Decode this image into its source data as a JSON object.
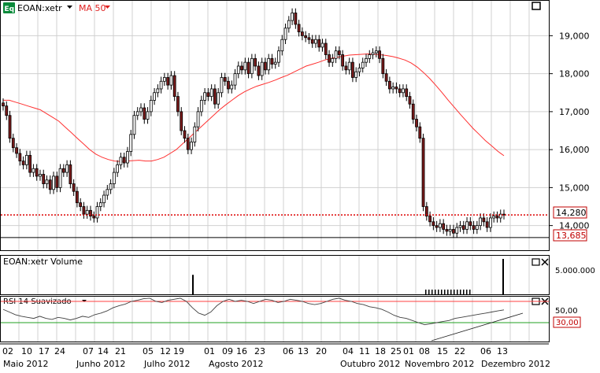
{
  "header": {
    "symbol_badge": "Eq",
    "symbol_label": "EOAN:xetr",
    "ma_label": "MA 50"
  },
  "colors": {
    "up_candle": "#ffffff",
    "down_candle": "#7a1a1a",
    "candle_outline": "#000000",
    "ma_line": "#ff3030",
    "ref_dotted": "#dd0000",
    "rsi_upper": "#ff4040",
    "rsi_lower": "#20a020",
    "grid": "#d0d0d0",
    "badge_bg": "#0a8a3a"
  },
  "volume_panel": {
    "title": "EOAN:xetr Volume",
    "axis_label": "5.000.000"
  },
  "rsi_panel": {
    "title": "RSI 14 Suavizado",
    "axis_label": "50,00",
    "badge": "30,00"
  },
  "price_labels": {
    "last": "14,280",
    "low": "13,685"
  },
  "day_ticks": [
    "02",
    "10",
    "17",
    "24",
    "07",
    "14",
    "21",
    "05",
    "12",
    "19",
    "01",
    "09",
    "16",
    "23",
    "06",
    "13",
    "20",
    "04",
    "11",
    "18",
    "25",
    "01",
    "08",
    "15",
    "22",
    "06",
    "13"
  ],
  "month_labels": [
    "Maio 2012",
    "Junho 2012",
    "Julho 2012",
    "Agosto 2012",
    "Outubro 2012",
    "Novembro 2012",
    "Dezembro 2012"
  ],
  "chart_data": {
    "type": "candlestick",
    "period": "Maio 2012 - Dezembro 2012",
    "price_axis_ticks": [
      "19,000",
      "18,000",
      "17,000",
      "16,000",
      "15,000",
      "14,000"
    ],
    "price_axis_values": [
      19,
      18,
      17,
      16,
      15,
      14
    ],
    "price_ylim": [
      13.35,
      19.92
    ],
    "reference_lines": [
      {
        "value": 14.28,
        "style": "dotted",
        "label": "14,280"
      },
      {
        "value": 13.685,
        "style": "solid",
        "label": "13,685"
      }
    ],
    "close_series": [
      17.15,
      16.9,
      16.3,
      16.05,
      15.9,
      15.7,
      15.6,
      15.85,
      15.4,
      15.5,
      15.3,
      15.35,
      15.1,
      15.2,
      14.95,
      15.3,
      15.0,
      15.5,
      15.4,
      15.6,
      15.1,
      14.9,
      14.6,
      14.5,
      14.3,
      14.4,
      14.25,
      14.2,
      14.5,
      14.6,
      14.8,
      14.95,
      15.1,
      15.4,
      15.6,
      15.8,
      15.65,
      15.95,
      16.4,
      16.9,
      17.0,
      17.1,
      16.8,
      17.0,
      17.3,
      17.5,
      17.6,
      17.8,
      17.9,
      17.7,
      17.95,
      17.4,
      17.0,
      16.5,
      16.3,
      16.0,
      16.2,
      16.6,
      17.0,
      17.3,
      17.5,
      17.4,
      17.6,
      17.2,
      17.5,
      17.9,
      17.8,
      17.6,
      17.7,
      18.0,
      18.2,
      18.1,
      18.3,
      18.0,
      18.4,
      18.2,
      17.95,
      18.3,
      18.1,
      18.4,
      18.25,
      18.3,
      18.6,
      18.9,
      19.2,
      19.4,
      19.6,
      19.3,
      19.1,
      19.0,
      18.95,
      18.9,
      18.8,
      18.9,
      18.7,
      18.8,
      18.5,
      18.3,
      18.4,
      18.6,
      18.5,
      18.2,
      18.1,
      18.3,
      17.9,
      18.05,
      18.15,
      18.3,
      18.4,
      18.5,
      18.55,
      18.6,
      18.4,
      18.0,
      17.8,
      17.6,
      17.65,
      17.6,
      17.5,
      17.6,
      17.4,
      17.2,
      16.8,
      16.6,
      16.3,
      14.5,
      14.25,
      14.1,
      14.0,
      13.95,
      14.05,
      13.9,
      13.85,
      13.9,
      13.8,
      13.95,
      14.0,
      13.9,
      14.1,
      14.0,
      13.9,
      14.0,
      14.2,
      14.1,
      13.95,
      14.2,
      14.25,
      14.2,
      14.3,
      14.28
    ],
    "ma50_series": [
      17.3,
      17.3,
      17.25,
      17.2,
      17.15,
      17.1,
      17.05,
      16.95,
      16.85,
      16.75,
      16.6,
      16.45,
      16.3,
      16.15,
      16.0,
      15.88,
      15.8,
      15.74,
      15.7,
      15.69,
      15.7,
      15.71,
      15.72,
      15.7,
      15.7,
      15.74,
      15.8,
      15.9,
      16.0,
      16.15,
      16.3,
      16.45,
      16.6,
      16.75,
      16.9,
      17.05,
      17.18,
      17.3,
      17.42,
      17.52,
      17.6,
      17.67,
      17.72,
      17.77,
      17.83,
      17.9,
      17.96,
      18.04,
      18.12,
      18.2,
      18.25,
      18.3,
      18.36,
      18.4,
      18.43,
      18.46,
      18.49,
      18.5,
      18.51,
      18.52,
      18.51,
      18.5,
      18.48,
      18.45,
      18.41,
      18.36,
      18.28,
      18.17,
      18.03,
      17.87,
      17.69,
      17.5,
      17.3,
      17.11,
      16.92,
      16.74,
      16.56,
      16.4,
      16.24,
      16.1,
      15.96,
      15.84
    ],
    "volume_spikes": [
      {
        "date": "Julho 2012",
        "relative": 0.55
      },
      {
        "date": "Dezembro 2012",
        "relative": 1.0
      }
    ],
    "rsi_levels": [
      70,
      30
    ],
    "rsi_series": [
      55,
      50,
      45,
      42,
      40,
      38,
      42,
      38,
      36,
      40,
      38,
      35,
      38,
      42,
      40,
      45,
      48,
      52,
      58,
      62,
      65,
      70,
      72,
      75,
      76,
      70,
      68,
      72,
      74,
      76,
      70,
      58,
      48,
      44,
      50,
      62,
      70,
      74,
      70,
      72,
      70,
      66,
      70,
      74,
      72,
      68,
      70,
      74,
      72,
      70,
      66,
      64,
      66,
      70,
      74,
      76,
      72,
      70,
      66,
      64,
      60,
      58,
      55,
      50,
      44,
      40,
      38,
      34,
      30,
      26,
      28,
      30,
      32,
      34,
      38,
      40,
      42,
      44,
      46,
      48,
      50,
      52,
      54
    ]
  }
}
